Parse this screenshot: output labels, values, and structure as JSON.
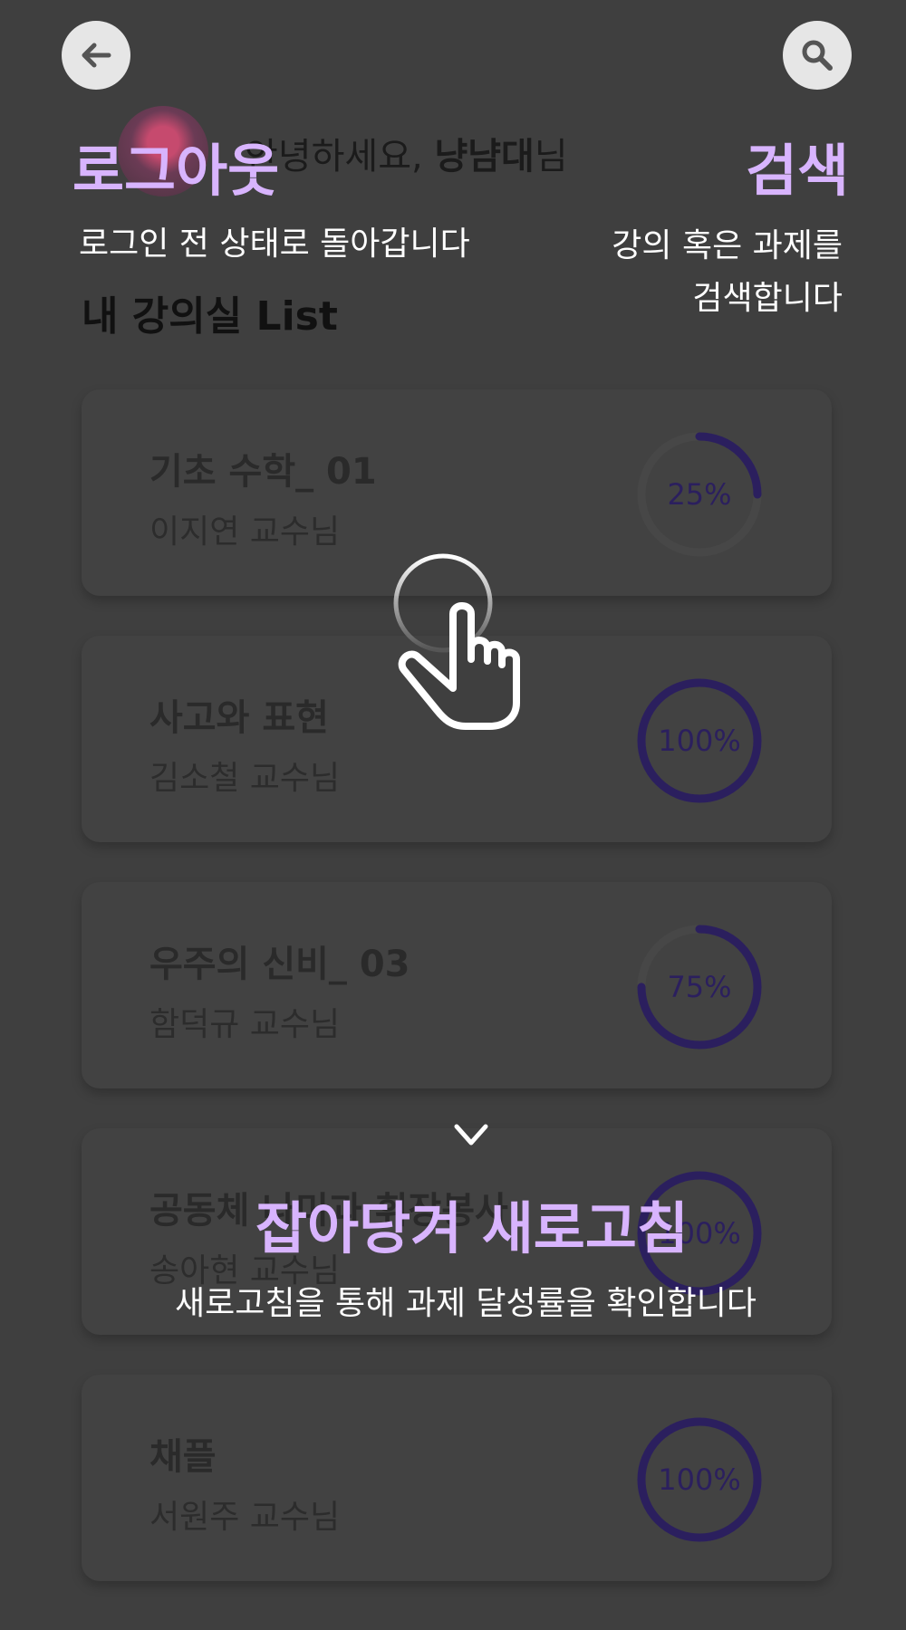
{
  "header": {
    "back_icon": "arrow-left-icon",
    "search_icon": "magnifier-icon",
    "greeting_prefix": "안녕하세요, ",
    "user_name": "냥냠대",
    "greeting_suffix": "님",
    "list_title": "내 강의실 List"
  },
  "courses": [
    {
      "name": "기초 수학_ 01",
      "professor": "이지연 교수님",
      "progress_label": "25%",
      "progress": 25
    },
    {
      "name": "사고와 표현",
      "professor": "김소철 교수님",
      "progress_label": "100%",
      "progress": 100
    },
    {
      "name": "우주의 신비_ 03",
      "professor": "함덕규 교수님",
      "progress_label": "75%",
      "progress": 75
    },
    {
      "name": "공동체 나미과 휘장봉사",
      "professor": "송아현 교수님",
      "progress_label": "100%",
      "progress": 100
    },
    {
      "name": "채플",
      "professor": "서원주 교수님",
      "progress_label": "100%",
      "progress": 100
    }
  ],
  "overlay": {
    "logout_title": "로그아웃",
    "logout_desc": "로그인 전 상태로 돌아갑니다",
    "search_title": "검색",
    "search_desc_line1": "강의 혹은 과제를",
    "search_desc_line2": "검색합니다",
    "refresh_title": "잡아당겨 새로고침",
    "refresh_desc": "새로고침을 통해 과제 달성률을 확인합니다",
    "gesture_icon": "tap-hand-icon",
    "arrow_icon": "arrow-down-icon"
  },
  "colors": {
    "overlay_bg": "#3f3f3f",
    "highlight_purple": "#d8b4fe",
    "progress_ring": "#2b1f5e",
    "ring_track": "#474747"
  }
}
